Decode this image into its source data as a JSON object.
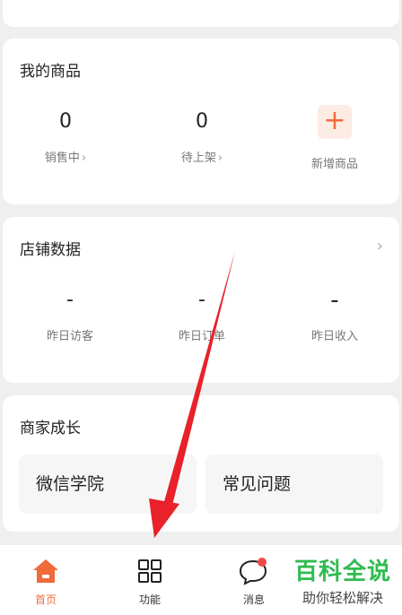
{
  "goods": {
    "title": "我的商品",
    "on_sale_count": "0",
    "on_sale_label": "销售中",
    "pending_count": "0",
    "pending_label": "待上架",
    "add_label": "新增商品"
  },
  "store": {
    "title": "店铺数据",
    "visitors_value": "-",
    "visitors_label": "昨日访客",
    "orders_value": "-",
    "orders_label": "昨日订单",
    "income_value": "-",
    "income_label": "昨日收入"
  },
  "growth": {
    "title": "商家成长",
    "academy": "微信学院",
    "faq": "常见问题"
  },
  "tabbar": {
    "home": "首页",
    "functions": "功能",
    "messages": "消息"
  },
  "watermark": {
    "title": "百科全说",
    "subtitle": "助你轻松解决"
  },
  "colors": {
    "accent": "#f06a3a",
    "badge": "#f04848",
    "annotation_arrow": "#e8212a",
    "watermark_green": "#2fbb4f"
  }
}
